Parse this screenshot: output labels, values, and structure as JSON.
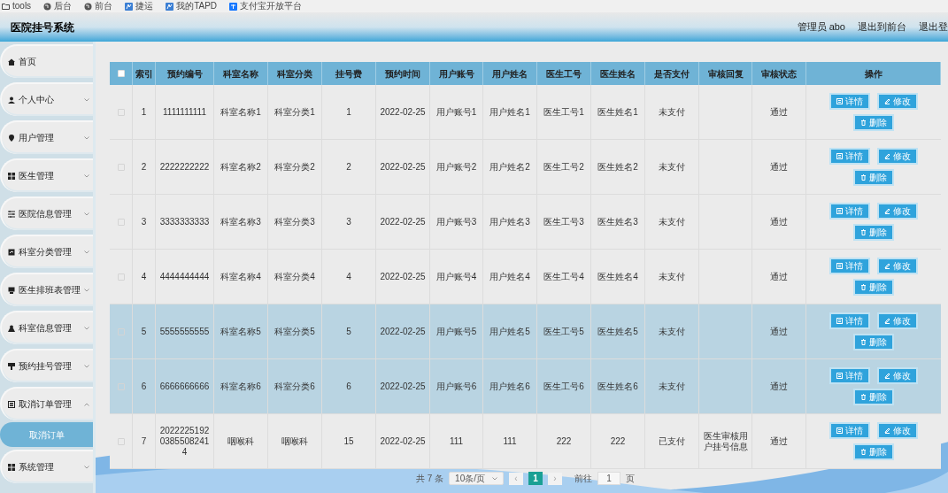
{
  "bookmarks": [
    {
      "kind": "folder",
      "label": "tools"
    },
    {
      "kind": "globe",
      "label": "后台"
    },
    {
      "kind": "globe",
      "label": "前台"
    },
    {
      "kind": "tapd",
      "label": "捷运"
    },
    {
      "kind": "tapd",
      "label": "我的TAPD"
    },
    {
      "kind": "alipay",
      "label": "支付宝开放平台"
    }
  ],
  "header": {
    "title": "医院挂号系统",
    "links": [
      "管理员 abo",
      "退出到前台",
      "退出登"
    ]
  },
  "sidebar": {
    "items": [
      {
        "kind": "link",
        "label": "首页"
      },
      {
        "kind": "menu",
        "label": "个人中心",
        "expanded": false
      },
      {
        "kind": "menu",
        "label": "用户管理",
        "expanded": false
      },
      {
        "kind": "menu",
        "label": "医生管理",
        "expanded": false
      },
      {
        "kind": "menu",
        "label": "医院信息管理",
        "expanded": false
      },
      {
        "kind": "menu",
        "label": "科室分类管理",
        "expanded": false
      },
      {
        "kind": "menu",
        "label": "医生排班表管理",
        "expanded": false
      },
      {
        "kind": "menu",
        "label": "科室信息管理",
        "expanded": false
      },
      {
        "kind": "menu",
        "label": "预约挂号管理",
        "expanded": false
      },
      {
        "kind": "menu",
        "label": "取消订单管理",
        "expanded": true,
        "children": [
          {
            "label": "取消订单",
            "selected": true
          }
        ]
      },
      {
        "kind": "menu",
        "label": "系统管理",
        "expanded": false
      }
    ]
  },
  "table": {
    "header_checked": false,
    "columns": [
      "索引",
      "预约编号",
      "科室名称",
      "科室分类",
      "挂号费",
      "预约时间",
      "用户账号",
      "用户姓名",
      "医生工号",
      "医生姓名",
      "是否支付",
      "审核回复",
      "审核状态",
      "操作"
    ],
    "rows": [
      {
        "checked": false,
        "highlighted": false,
        "actions": [
          "详情",
          "修改",
          "删除"
        ],
        "cells": [
          "1",
          "1111111111",
          "科室名称1",
          "科室分类1",
          "1",
          "2022-02-25",
          "用户账号1",
          "用户姓名1",
          "医生工号1",
          "医生姓名1",
          "未支付",
          "",
          "通过"
        ]
      },
      {
        "checked": false,
        "highlighted": false,
        "actions": [
          "详情",
          "修改",
          "删除"
        ],
        "cells": [
          "2",
          "2222222222",
          "科室名称2",
          "科室分类2",
          "2",
          "2022-02-25",
          "用户账号2",
          "用户姓名2",
          "医生工号2",
          "医生姓名2",
          "未支付",
          "",
          "通过"
        ]
      },
      {
        "checked": false,
        "highlighted": false,
        "actions": [
          "详情",
          "修改",
          "删除"
        ],
        "cells": [
          "3",
          "3333333333",
          "科室名称3",
          "科室分类3",
          "3",
          "2022-02-25",
          "用户账号3",
          "用户姓名3",
          "医生工号3",
          "医生姓名3",
          "未支付",
          "",
          "通过"
        ]
      },
      {
        "checked": false,
        "highlighted": false,
        "actions": [
          "详情",
          "修改",
          "删除"
        ],
        "cells": [
          "4",
          "4444444444",
          "科室名称4",
          "科室分类4",
          "4",
          "2022-02-25",
          "用户账号4",
          "用户姓名4",
          "医生工号4",
          "医生姓名4",
          "未支付",
          "",
          "通过"
        ]
      },
      {
        "checked": false,
        "highlighted": true,
        "actions": [
          "详情",
          "修改",
          "删除"
        ],
        "cells": [
          "5",
          "5555555555",
          "科室名称5",
          "科室分类5",
          "5",
          "2022-02-25",
          "用户账号5",
          "用户姓名5",
          "医生工号5",
          "医生姓名5",
          "未支付",
          "",
          "通过"
        ]
      },
      {
        "checked": false,
        "highlighted": true,
        "actions": [
          "详情",
          "修改",
          "删除"
        ],
        "cells": [
          "6",
          "6666666666",
          "科室名称6",
          "科室分类6",
          "6",
          "2022-02-25",
          "用户账号6",
          "用户姓名6",
          "医生工号6",
          "医生姓名6",
          "未支付",
          "",
          "通过"
        ]
      },
      {
        "checked": false,
        "highlighted": false,
        "actions": [
          "详情",
          "修改",
          "删除"
        ],
        "cells": [
          "7",
          "202222519203855082414",
          "咽喉科",
          "咽喉科",
          "15",
          "2022-02-25",
          "111",
          "111",
          "222",
          "222",
          "已支付",
          "医生审核用户挂号信息",
          "通过"
        ]
      }
    ]
  },
  "pagination": {
    "total": "共 7 条",
    "page_size": "10条/页",
    "prev": "‹",
    "pages": [
      {
        "label": "1",
        "selected": true
      }
    ],
    "next": "›",
    "goto_label": "前往",
    "goto_value": "1",
    "goto_suffix": "页"
  }
}
